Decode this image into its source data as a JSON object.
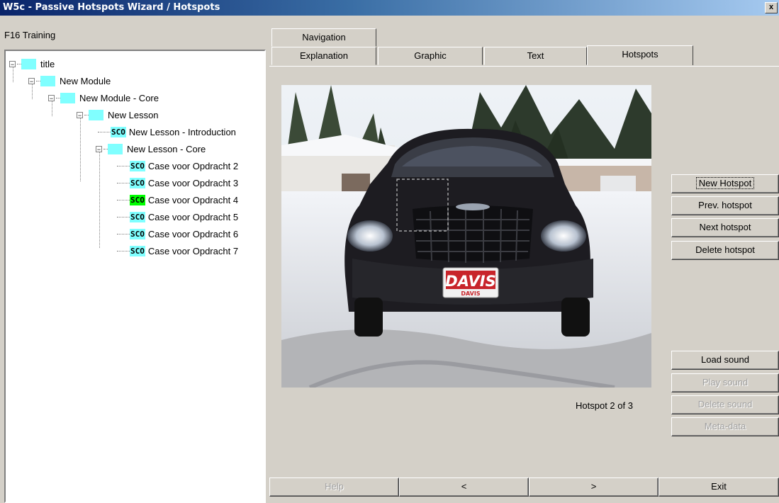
{
  "window": {
    "title": "W5c - Passive Hotspots Wizard / Hotspots",
    "close_label": "x"
  },
  "course": {
    "name": "F16 Training"
  },
  "tree": {
    "nodes": [
      {
        "label": "title",
        "type": "folder"
      },
      {
        "label": "New Module",
        "type": "folder"
      },
      {
        "label": "New Module - Core",
        "type": "folder"
      },
      {
        "label": "New Lesson",
        "type": "folder"
      },
      {
        "label": "New Lesson - Introduction",
        "type": "sco",
        "icon_text": "SCO"
      },
      {
        "label": "New Lesson - Core",
        "type": "folder"
      },
      {
        "label": "Case voor Opdracht 2",
        "type": "sco",
        "icon_text": "SCO"
      },
      {
        "label": "Case voor Opdracht 3",
        "type": "sco",
        "icon_text": "SCO"
      },
      {
        "label": "Case voor Opdracht 4",
        "type": "sco",
        "icon_text": "SCO",
        "selected": true
      },
      {
        "label": "Case voor Opdracht 5",
        "type": "sco",
        "icon_text": "SCO"
      },
      {
        "label": "Case voor Opdracht 6",
        "type": "sco",
        "icon_text": "SCO"
      },
      {
        "label": "Case voor Opdracht 7",
        "type": "sco",
        "icon_text": "SCO"
      }
    ]
  },
  "tabs": {
    "navigation": "Navigation",
    "explanation": "Explanation",
    "graphic": "Graphic",
    "text": "Text",
    "hotspots": "Hotspots",
    "active": "Hotspots"
  },
  "image": {
    "plate_text": "DAVIS",
    "plate_subtext": "DAVIS"
  },
  "hotspot_buttons": {
    "new": "New Hotspot",
    "prev": "Prev. hotspot",
    "next": "Next hotspot",
    "delete": "Delete hotspot"
  },
  "sound_buttons": {
    "load": "Load sound",
    "play": "Play sound",
    "delete": "Delete sound",
    "meta": "Meta-data"
  },
  "hotspot_counter": "Hotspot 2 of 3",
  "footer": {
    "help": "Help",
    "prev": "<",
    "next": ">",
    "exit": "Exit"
  },
  "colors": {
    "title_start": "#0a246a",
    "title_end": "#a6caf0",
    "folder_icon": "#80ffff",
    "selected_icon": "#00ff00"
  }
}
